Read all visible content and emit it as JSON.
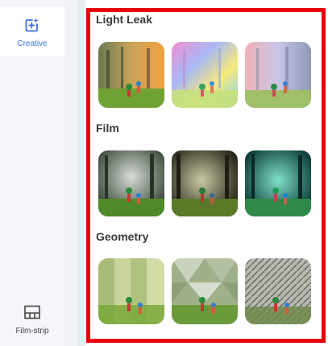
{
  "sidebar": {
    "items": [
      {
        "label": "Creative",
        "icon": "sparkle-frame-icon",
        "active": true
      },
      {
        "label": "Film-strip",
        "icon": "film-strip-icon",
        "active": false
      }
    ]
  },
  "colors": {
    "accent": "#3b72e8",
    "highlight_border": "#e5000a"
  },
  "sections": [
    {
      "title": "Light Leak",
      "filters": [
        "light-leak-warm",
        "light-leak-rainbow",
        "light-leak-pastel"
      ]
    },
    {
      "title": "Film",
      "filters": [
        "film-cool",
        "film-vintage",
        "film-teal"
      ]
    },
    {
      "title": "Geometry",
      "filters": [
        "geometry-facets",
        "geometry-triangles",
        "geometry-mosaic"
      ]
    }
  ]
}
